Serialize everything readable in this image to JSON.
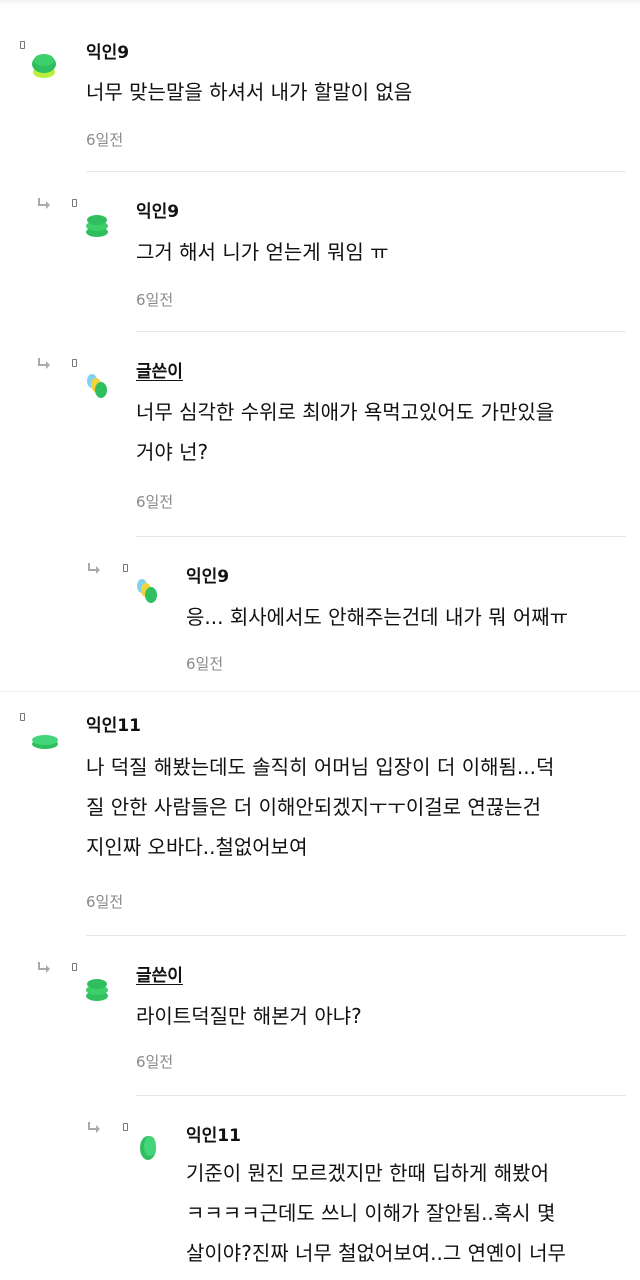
{
  "comments": [
    {
      "name": "익인9",
      "text": "너무 맞는말을 하셔서 내가 할말이 없음",
      "time": "6일전",
      "avatar_icon": "green-stack-icon"
    },
    {
      "name": "익인9",
      "text": "그거 해서 니가 얻는게 뭐임 ㅠ",
      "time": "6일전",
      "avatar_icon": "green-stack-icon"
    },
    {
      "name": "글쓴이",
      "text": "너무 심각한 수위로 최애가 욕먹고있어도 가만있을\n거야 넌?",
      "time": "6일전",
      "avatar_icon": "multicolor-coins-icon"
    },
    {
      "name": "익인9",
      "text": "응... 회사에서도 안해주는건데 내가 뭐 어째ㅠ",
      "time": "6일전",
      "avatar_icon": "multicolor-coins-icon"
    },
    {
      "name": "익인11",
      "text": "나 덕질 해봤는데도 솔직히 어머님 입장이 더 이해됨...덕\n질 안한 사람들은 더 이해안되겠지ㅜㅜ이걸로 연끊는건\n지인짜 오바다..철없어보여",
      "time": "6일전",
      "avatar_icon": "green-disc-icon"
    },
    {
      "name": "글쓴이",
      "text": "라이트덕질만 해본거 아냐?",
      "time": "6일전",
      "avatar_icon": "green-stack-icon"
    },
    {
      "name": "익인11",
      "text": "기준이 뭔진 모르겠지만 한때 딥하게 해봤어\nㅋㅋㅋㅋ근데도 쓰니 이해가 잘안됨..혹시 몇\n살이야?진짜 너무 철없어보여..그 연옌이 너무",
      "time": "",
      "avatar_icon": "green-coin-icon"
    }
  ],
  "colors": {
    "accent_green": "#2fbf5f",
    "text": "#111111",
    "muted": "#8a8a8a",
    "divider": "#e6e6e6"
  }
}
